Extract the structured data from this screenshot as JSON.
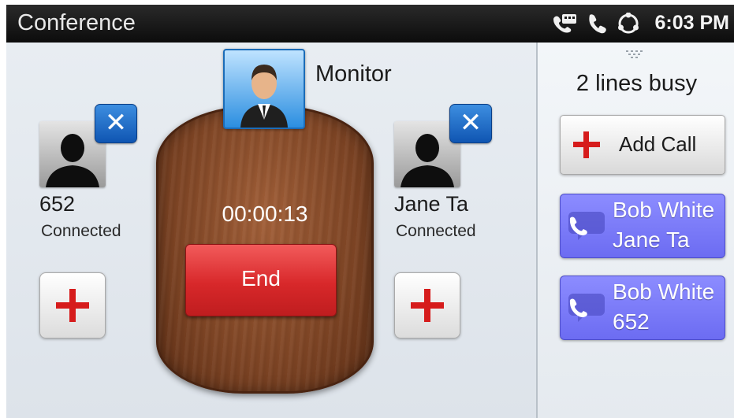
{
  "status_bar": {
    "title": "Conference",
    "time": "6:03 PM",
    "icons": [
      "voicemail-phone-icon",
      "phone-icon",
      "network-icon"
    ]
  },
  "conference": {
    "monitor": {
      "label": "Monitor",
      "icon": "person-suit-avatar-icon"
    },
    "timer": "00:00:13",
    "end_label": "End",
    "participants": [
      {
        "name": "652",
        "status": "Connected"
      },
      {
        "name": "Jane Ta",
        "status": "Connected"
      }
    ]
  },
  "side_panel": {
    "lines_busy": "2 lines busy",
    "add_call_label": "Add Call",
    "lines": [
      {
        "line1": "Bob White",
        "line2": "Jane Ta"
      },
      {
        "line1": "Bob White",
        "line2": "652"
      }
    ]
  },
  "colors": {
    "end_button": "#d8282a",
    "line_button": "#7b7bf8",
    "remove_button": "#1c6fcc",
    "board_wood": "#7d4424"
  }
}
